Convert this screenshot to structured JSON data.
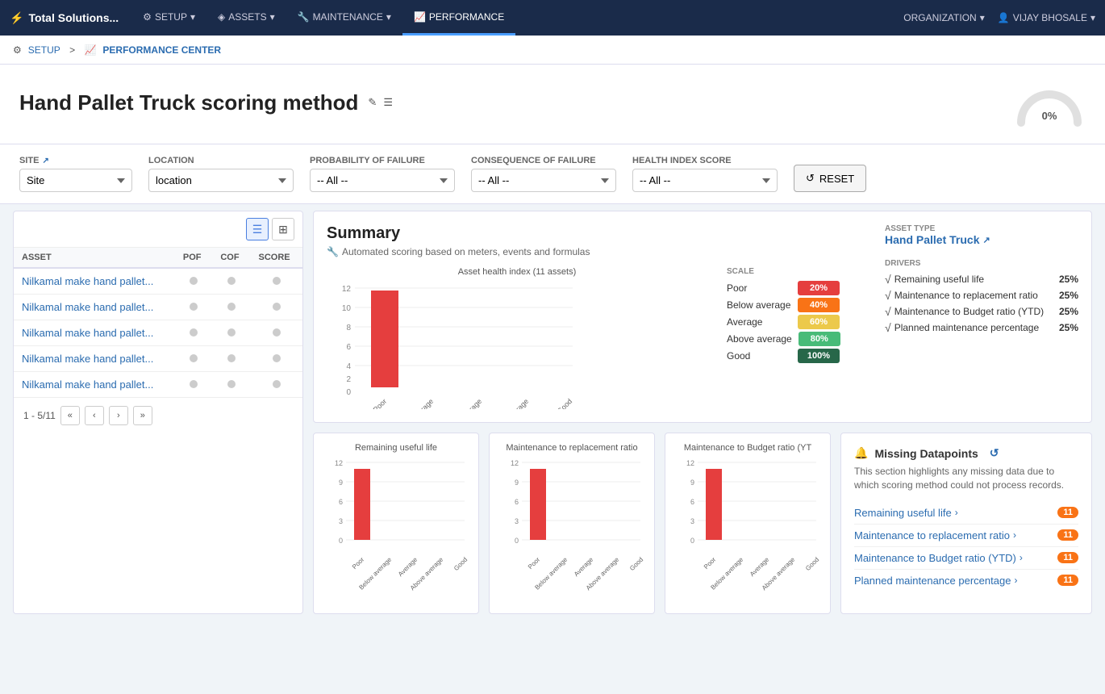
{
  "brand": {
    "logo": "⚡",
    "name": "Total Solutions..."
  },
  "nav": {
    "items": [
      {
        "id": "setup",
        "label": "SETUP",
        "icon": "⚙",
        "active": false,
        "has_dropdown": true
      },
      {
        "id": "assets",
        "label": "ASSETS",
        "icon": "◈",
        "active": false,
        "has_dropdown": true
      },
      {
        "id": "maintenance",
        "label": "MAINTENANCE",
        "icon": "🔧",
        "active": false,
        "has_dropdown": true
      },
      {
        "id": "performance",
        "label": "PERFORMANCE",
        "icon": "📈",
        "active": true,
        "has_dropdown": false
      }
    ],
    "org_label": "ORGANIZATION",
    "user_label": "VIJAY BHOSALE"
  },
  "breadcrumb": {
    "setup_label": "SETUP",
    "center_label": "PERFORMANCE CENTER"
  },
  "page": {
    "title": "Hand Pallet Truck scoring method",
    "gauge_value": "0%"
  },
  "filters": {
    "site_label": "SITE",
    "site_value": "Site",
    "location_label": "LOCATION",
    "location_value": "location",
    "pof_label": "PROBABILITY OF FAILURE",
    "pof_value": "-- All --",
    "cof_label": "CONSEQUENCE OF FAILURE",
    "cof_value": "-- All --",
    "health_label": "HEALTH INDEX SCORE",
    "health_value": "-- All --",
    "reset_label": "RESET"
  },
  "asset_table": {
    "col_asset": "ASSET",
    "col_pof": "POF",
    "col_cof": "COF",
    "col_score": "SCORE",
    "rows": [
      {
        "label": "Nilkamal make hand pallet..."
      },
      {
        "label": "Nilkamal make hand pallet..."
      },
      {
        "label": "Nilkamal make hand pallet..."
      },
      {
        "label": "Nilkamal make hand pallet..."
      },
      {
        "label": "Nilkamal make hand pallet..."
      }
    ],
    "pagination": "1 - 5/11"
  },
  "summary": {
    "title": "Summary",
    "subtitle": "Automated scoring based on meters, events and formulas",
    "chart_title": "Asset health index (11 assets)",
    "asset_type_label": "ASSET TYPE",
    "asset_type_value": "Hand Pallet Truck",
    "drivers_label": "DRIVERS",
    "drivers": [
      {
        "label": "Remaining useful life",
        "pct": "25%"
      },
      {
        "label": "Maintenance to replacement ratio",
        "pct": "25%"
      },
      {
        "label": "Maintenance to Budget ratio (YTD)",
        "pct": "25%"
      },
      {
        "label": "Planned maintenance percentage",
        "pct": "25%"
      }
    ],
    "scale_label": "SCALE",
    "scale_items": [
      {
        "label": "Poor",
        "pct": "20%",
        "color": "#e53e3e"
      },
      {
        "label": "Below average",
        "pct": "40%",
        "color": "#f97316"
      },
      {
        "label": "Average",
        "pct": "60%",
        "color": "#ecc94b"
      },
      {
        "label": "Above average",
        "pct": "80%",
        "color": "#48bb78"
      },
      {
        "label": "Good",
        "pct": "100%",
        "color": "#276749"
      }
    ],
    "bar_data": [
      {
        "label": "Poor",
        "value": 11
      },
      {
        "label": "Below average",
        "value": 0
      },
      {
        "label": "Average",
        "value": 0
      },
      {
        "label": "Above average",
        "value": 0
      },
      {
        "label": "Good",
        "value": 0
      }
    ],
    "bar_max": 12
  },
  "mini_charts": [
    {
      "title": "Remaining useful life",
      "bar_data": [
        {
          "label": "Poor",
          "value": 11
        },
        {
          "label": "Below average",
          "value": 0
        },
        {
          "label": "Average",
          "value": 0
        },
        {
          "label": "Above average",
          "value": 0
        },
        {
          "label": "Good",
          "value": 0
        }
      ],
      "bar_max": 12,
      "y_labels": [
        "12",
        "9",
        "6",
        "3",
        "0"
      ]
    },
    {
      "title": "Maintenance to replacement ratio",
      "bar_data": [
        {
          "label": "Poor",
          "value": 11
        },
        {
          "label": "Below average",
          "value": 0
        },
        {
          "label": "Average",
          "value": 0
        },
        {
          "label": "Above average",
          "value": 0
        },
        {
          "label": "Good",
          "value": 0
        }
      ],
      "bar_max": 12,
      "y_labels": [
        "12",
        "9",
        "6",
        "3",
        "0"
      ]
    },
    {
      "title": "Maintenance to Budget ratio (YT",
      "bar_data": [
        {
          "label": "Poor",
          "value": 11
        },
        {
          "label": "Below average",
          "value": 0
        },
        {
          "label": "Average",
          "value": 0
        },
        {
          "label": "Above average",
          "value": 0
        },
        {
          "label": "Good",
          "value": 0
        }
      ],
      "bar_max": 12,
      "y_labels": [
        "12",
        "9",
        "6",
        "3",
        "0"
      ]
    }
  ],
  "missing": {
    "title": "Missing Datapoints",
    "description": "This section highlights any missing data due to which scoring method could not process records.",
    "items": [
      {
        "label": "Remaining useful life",
        "count": "11"
      },
      {
        "label": "Maintenance to replacement ratio",
        "count": "11"
      },
      {
        "label": "Maintenance to Budget ratio (YTD)",
        "count": "11"
      },
      {
        "label": "Planned maintenance percentage",
        "count": "11"
      }
    ]
  }
}
